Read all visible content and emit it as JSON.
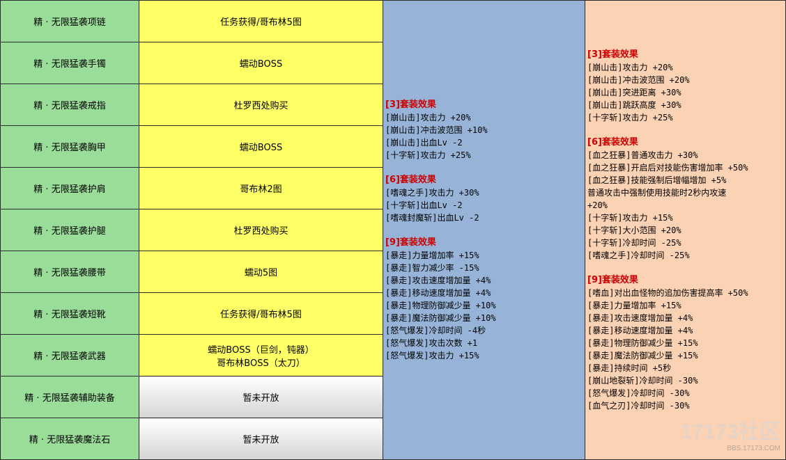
{
  "items": [
    {
      "name": "精 · 无限猛袭项链",
      "source": [
        "任务获得/哥布林5图"
      ],
      "style": "yellow"
    },
    {
      "name": "精 · 无限猛袭手镯",
      "source": [
        "蠕动BOSS"
      ],
      "style": "yellow"
    },
    {
      "name": "精 · 无限猛袭戒指",
      "source": [
        "杜罗西处购买"
      ],
      "style": "yellow"
    },
    {
      "name": "精 · 无限猛袭胸甲",
      "source": [
        "蠕动BOSS"
      ],
      "style": "yellow"
    },
    {
      "name": "精 · 无限猛袭护肩",
      "source": [
        "哥布林2图"
      ],
      "style": "yellow"
    },
    {
      "name": "精 · 无限猛袭护腿",
      "source": [
        "杜罗西处购买"
      ],
      "style": "yellow"
    },
    {
      "name": "精 · 无限猛袭腰带",
      "source": [
        "蠕动5图"
      ],
      "style": "yellow"
    },
    {
      "name": "精 · 无限猛袭短靴",
      "source": [
        "任务获得/哥布林5图"
      ],
      "style": "yellow"
    },
    {
      "name": "精 · 无限猛袭武器",
      "source": [
        "蠕动BOSS（巨剑，钝器）",
        "哥布林BOSS（太刀）"
      ],
      "style": "yellow"
    },
    {
      "name": "精 · 无限猛袭辅助装备",
      "source": [
        "暂未开放"
      ],
      "style": "grey"
    },
    {
      "name": "精 · 无限猛袭魔法石",
      "source": [
        "暂未开放"
      ],
      "style": "grey"
    }
  ],
  "set_a": [
    {
      "head": "[3]套装效果",
      "lines": [
        "[崩山击]攻击力 +20%",
        "[崩山击]冲击波范围 +10%",
        "[崩山击]出血Lv -2",
        "[十字斩]攻击力 +25%"
      ]
    },
    {
      "head": "[6]套装效果",
      "lines": [
        "[嗜魂之手]攻击力 +30%",
        "[十字斩]出血Lv -2",
        "[嗜魂封魔斩]出血Lv -2"
      ]
    },
    {
      "head": "[9]套装效果",
      "lines": [
        "[暴走]力量增加率 +15%",
        "[暴走]智力减少率 -15%",
        "[暴走]攻击速度增加量 +4%",
        "[暴走]移动速度增加量 +4%",
        "[暴走]物理防御减少量 +10%",
        "[暴走]魔法防御减少量 +10%",
        "[怒气爆发]冷却时间 -4秒",
        "[怒气爆发]攻击次数 +1",
        "[怒气爆发]攻击力 +15%"
      ]
    }
  ],
  "set_b": [
    {
      "head": "[3]套装效果",
      "lines": [
        "[崩山击]攻击力 +20%",
        "[崩山击]冲击波范围 +20%",
        "[崩山击]突进距离 +30%",
        "[崩山击]跳跃高度 +30%",
        "[十字斩]攻击力 +25%"
      ]
    },
    {
      "head": "[6]套装效果",
      "lines": [
        "[血之狂暴]普通攻击力 +30%",
        "[血之狂暴]开启后对技能伤害增加率 +50%",
        "[血之狂暴]技能强制后增幅增加 +5%",
        "普通攻击中强制使用技能时2秒内攻速",
        "+20%",
        "[十字斩]攻击力 +15%",
        "[十字斩]大小范围 +20%",
        "[十字斩]冷却时间 -25%",
        "[嗜魂之手]冷却时间 -25%"
      ]
    },
    {
      "head": "[9]套装效果",
      "lines": [
        "[嗜血]对出血怪物的追加伤害提高率 +50%",
        "[暴走]力量增加率 +15%",
        "[暴走]攻击速度增加量 +4%",
        "[暴走]移动速度增加量 +4%",
        "[暴走]物理防御减少量 +15%",
        "[暴走]魔法防御减少量 +15%",
        "[暴走]持续时间 +5秒",
        "[崩山地裂斩]冷却时间 -30%",
        "[怒气爆发]冷却时间 -30%",
        "[血气之刃]冷却时间 -30%"
      ]
    }
  ],
  "watermark": {
    "logo": "17173社区",
    "url": "BBS.17173.COM"
  },
  "colors": {
    "name_bg": "#99dd99",
    "source_bg": "#ffff66",
    "set_a_bg": "#97b4d8",
    "set_b_bg": "#fcd2b4",
    "heading": "#cc0000"
  }
}
